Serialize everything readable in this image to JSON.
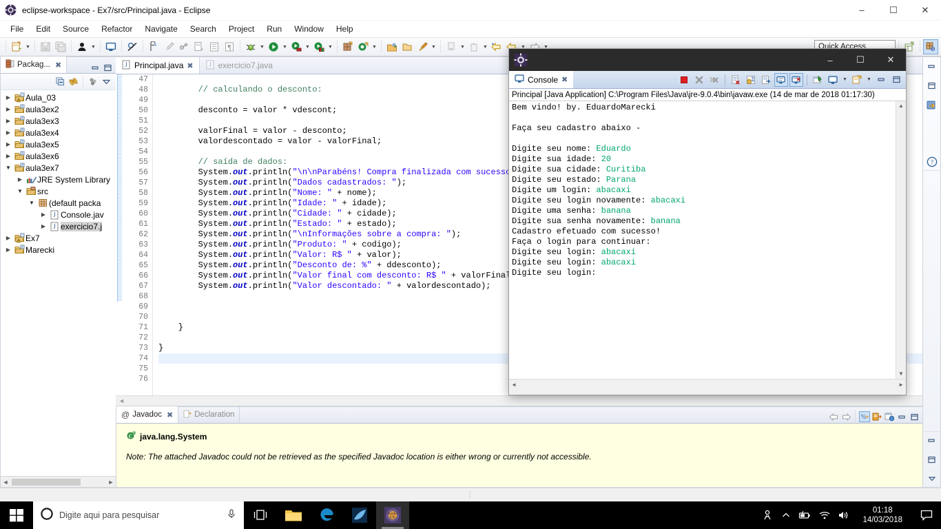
{
  "window": {
    "title": "eclipse-workspace - Ex7/src/Principal.java - Eclipse",
    "icon": "eclipse-icon",
    "minimize": "–",
    "maximize": "☐",
    "close": "✕"
  },
  "menubar": {
    "items": [
      "File",
      "Edit",
      "Source",
      "Refactor",
      "Navigate",
      "Search",
      "Project",
      "Run",
      "Window",
      "Help"
    ]
  },
  "toolbar": {
    "quick_access_label": "Quick Access",
    "icons": [
      "new-wizard-icon",
      "save-icon",
      "save-all-icon",
      "person-icon",
      "console-icon",
      "skip-breakpoints-icon",
      "toggle-mark-occurrences-icon",
      "brush-icon",
      "link-icon",
      "open-type-icon",
      "outline-icon",
      "pilcrow-icon",
      "debug-icon",
      "run-icon",
      "run-last-tool-icon",
      "coverage-icon",
      "new-java-project-icon",
      "new-annotation-icon",
      "open-task-icon",
      "open-folder-icon",
      "edit-icon",
      "previous-annotation-icon",
      "next-annotation-icon",
      "back-icon",
      "forward-icon"
    ],
    "perspective_icons": [
      "open-perspective-icon",
      "java-perspective-icon"
    ]
  },
  "package_explorer": {
    "tab_label": "Packag...",
    "tab_icon": "package-explorer-icon",
    "close_icon": "close-icon",
    "minimize_icon": "minimize-icon",
    "maximize_icon": "maximize-icon",
    "toolbar_icons": [
      "collapse-all-icon",
      "link-with-editor-icon",
      "view-menu-filter-icon",
      "view-menu-icon"
    ],
    "tree": [
      {
        "label": "Aula_03",
        "indent": 0,
        "arrow": "collapsed",
        "icon": "java-project-warning-icon",
        "selected": false
      },
      {
        "label": "aula3ex2",
        "indent": 0,
        "arrow": "collapsed",
        "icon": "java-project-icon",
        "selected": false
      },
      {
        "label": "aula3ex3",
        "indent": 0,
        "arrow": "collapsed",
        "icon": "java-project-icon",
        "selected": false
      },
      {
        "label": "aula3ex4",
        "indent": 0,
        "arrow": "collapsed",
        "icon": "java-project-icon",
        "selected": false
      },
      {
        "label": "aula3ex5",
        "indent": 0,
        "arrow": "collapsed",
        "icon": "java-project-icon",
        "selected": false
      },
      {
        "label": "aula3ex6",
        "indent": 0,
        "arrow": "collapsed",
        "icon": "java-project-icon",
        "selected": false
      },
      {
        "label": "aula3ex7",
        "indent": 0,
        "arrow": "expanded",
        "icon": "java-project-icon",
        "selected": false
      },
      {
        "label": "JRE System Library",
        "indent": 1,
        "arrow": "collapsed",
        "icon": "library-icon",
        "selected": false
      },
      {
        "label": "src",
        "indent": 1,
        "arrow": "expanded",
        "icon": "source-folder-icon",
        "selected": false
      },
      {
        "label": "(default packa",
        "indent": 2,
        "arrow": "expanded",
        "icon": "package-icon",
        "selected": false
      },
      {
        "label": "Console.jav",
        "indent": 3,
        "arrow": "collapsed",
        "icon": "java-file-icon",
        "selected": false
      },
      {
        "label": "exercicio7.j",
        "indent": 3,
        "arrow": "collapsed",
        "icon": "java-file-icon",
        "selected": true
      },
      {
        "label": "Ex7",
        "indent": 0,
        "arrow": "collapsed",
        "icon": "java-project-warning-icon",
        "selected": false
      },
      {
        "label": "Marecki",
        "indent": 0,
        "arrow": "collapsed",
        "icon": "java-project-icon",
        "selected": false
      }
    ]
  },
  "editor": {
    "tabs": [
      {
        "label": "Principal.java",
        "active": true,
        "icon": "java-file-icon",
        "close_icon": "close-icon"
      },
      {
        "label": "exercicio7.java",
        "active": false,
        "icon": "java-file-icon",
        "close_icon": ""
      }
    ],
    "first_line_number": 47,
    "current_line": 74,
    "lines": [
      {
        "n": 47,
        "segments": []
      },
      {
        "n": 48,
        "segments": [
          {
            "t": "        ",
            "c": "plain"
          },
          {
            "t": "// calculando o desconto:",
            "c": "cmt"
          }
        ]
      },
      {
        "n": 49,
        "segments": []
      },
      {
        "n": 50,
        "segments": [
          {
            "t": "        desconto = valor * vdescont;",
            "c": "plain"
          }
        ]
      },
      {
        "n": 51,
        "segments": []
      },
      {
        "n": 52,
        "segments": [
          {
            "t": "        valorFinal = valor - desconto;",
            "c": "plain"
          }
        ]
      },
      {
        "n": 53,
        "segments": [
          {
            "t": "        valordescontado = valor - valorFinal;",
            "c": "plain"
          }
        ]
      },
      {
        "n": 54,
        "segments": []
      },
      {
        "n": 55,
        "segments": [
          {
            "t": "        ",
            "c": "plain"
          },
          {
            "t": "// saída de dados:",
            "c": "cmt"
          }
        ]
      },
      {
        "n": 56,
        "segments": [
          {
            "t": "        System.",
            "c": "plain"
          },
          {
            "t": "out",
            "c": "fld"
          },
          {
            "t": ".println(",
            "c": "plain"
          },
          {
            "t": "\"\\n\\nParabéns! Compra finalizada com sucesso!\"",
            "c": "str"
          },
          {
            "t": ");",
            "c": "plain"
          }
        ]
      },
      {
        "n": 57,
        "segments": [
          {
            "t": "        System.",
            "c": "plain"
          },
          {
            "t": "out",
            "c": "fld"
          },
          {
            "t": ".println(",
            "c": "plain"
          },
          {
            "t": "\"Dados cadastrados: \"",
            "c": "str"
          },
          {
            "t": ");",
            "c": "plain"
          }
        ]
      },
      {
        "n": 58,
        "segments": [
          {
            "t": "        System.",
            "c": "plain"
          },
          {
            "t": "out",
            "c": "fld"
          },
          {
            "t": ".println(",
            "c": "plain"
          },
          {
            "t": "\"Nome: \"",
            "c": "str"
          },
          {
            "t": " + nome);",
            "c": "plain"
          }
        ]
      },
      {
        "n": 59,
        "segments": [
          {
            "t": "        System.",
            "c": "plain"
          },
          {
            "t": "out",
            "c": "fld"
          },
          {
            "t": ".println(",
            "c": "plain"
          },
          {
            "t": "\"Idade: \"",
            "c": "str"
          },
          {
            "t": " + idade);",
            "c": "plain"
          }
        ]
      },
      {
        "n": 60,
        "segments": [
          {
            "t": "        System.",
            "c": "plain"
          },
          {
            "t": "out",
            "c": "fld"
          },
          {
            "t": ".println(",
            "c": "plain"
          },
          {
            "t": "\"Cidade: \"",
            "c": "str"
          },
          {
            "t": " + cidade);",
            "c": "plain"
          }
        ]
      },
      {
        "n": 61,
        "segments": [
          {
            "t": "        System.",
            "c": "plain"
          },
          {
            "t": "out",
            "c": "fld"
          },
          {
            "t": ".println(",
            "c": "plain"
          },
          {
            "t": "\"Estado: \"",
            "c": "str"
          },
          {
            "t": " + estado);",
            "c": "plain"
          }
        ]
      },
      {
        "n": 62,
        "segments": [
          {
            "t": "        System.",
            "c": "plain"
          },
          {
            "t": "out",
            "c": "fld"
          },
          {
            "t": ".println(",
            "c": "plain"
          },
          {
            "t": "\"\\nInformações sobre a compra: \"",
            "c": "str"
          },
          {
            "t": ");",
            "c": "plain"
          }
        ]
      },
      {
        "n": 63,
        "segments": [
          {
            "t": "        System.",
            "c": "plain"
          },
          {
            "t": "out",
            "c": "fld"
          },
          {
            "t": ".println(",
            "c": "plain"
          },
          {
            "t": "\"Produto: \"",
            "c": "str"
          },
          {
            "t": " + codigo);",
            "c": "plain"
          }
        ]
      },
      {
        "n": 64,
        "segments": [
          {
            "t": "        System.",
            "c": "plain"
          },
          {
            "t": "out",
            "c": "fld"
          },
          {
            "t": ".println(",
            "c": "plain"
          },
          {
            "t": "\"Valor: R$ \"",
            "c": "str"
          },
          {
            "t": " + valor);",
            "c": "plain"
          }
        ]
      },
      {
        "n": 65,
        "segments": [
          {
            "t": "        System.",
            "c": "plain"
          },
          {
            "t": "out",
            "c": "fld"
          },
          {
            "t": ".println(",
            "c": "plain"
          },
          {
            "t": "\"Desconto de: %\"",
            "c": "str"
          },
          {
            "t": " + ddesconto);",
            "c": "plain"
          }
        ]
      },
      {
        "n": 66,
        "segments": [
          {
            "t": "        System.",
            "c": "plain"
          },
          {
            "t": "out",
            "c": "fld"
          },
          {
            "t": ".println(",
            "c": "plain"
          },
          {
            "t": "\"Valor final com desconto: R$ \"",
            "c": "str"
          },
          {
            "t": " + valorFinal);",
            "c": "plain"
          }
        ]
      },
      {
        "n": 67,
        "segments": [
          {
            "t": "        System.",
            "c": "plain"
          },
          {
            "t": "out",
            "c": "fld"
          },
          {
            "t": ".println(",
            "c": "plain"
          },
          {
            "t": "\"Valor descontado: \"",
            "c": "str"
          },
          {
            "t": " + valordescontado);",
            "c": "plain"
          }
        ]
      },
      {
        "n": 68,
        "segments": []
      },
      {
        "n": 69,
        "segments": []
      },
      {
        "n": 70,
        "segments": []
      },
      {
        "n": 71,
        "segments": [
          {
            "t": "    }",
            "c": "plain"
          }
        ]
      },
      {
        "n": 72,
        "segments": []
      },
      {
        "n": 73,
        "segments": [
          {
            "t": "}",
            "c": "plain"
          }
        ]
      },
      {
        "n": 74,
        "segments": []
      },
      {
        "n": 75,
        "segments": []
      },
      {
        "n": 76,
        "segments": []
      }
    ]
  },
  "javadoc_view": {
    "tabs": [
      {
        "label": "Javadoc",
        "icon": "at-icon",
        "active": true,
        "close_icon": "close-icon"
      },
      {
        "label": "Declaration",
        "icon": "declaration-icon",
        "active": false,
        "close_icon": ""
      }
    ],
    "toolbar_icons": [
      "back-icon",
      "forward-icon",
      "show-source-icon",
      "open-attached-javadoc-icon",
      "open-browser-icon",
      "minimize-icon",
      "maximize-icon"
    ],
    "element_icon": "class-icon",
    "element_name": "java.lang.System",
    "note": "Note: The attached Javadoc could not be retrieved as the specified Javadoc location is either wrong or currently not accessible."
  },
  "right_strip": {
    "icons": [
      "minimize-icon",
      "maximize-icon",
      "package-explorer-restore-icon",
      "help-icon",
      "view-menu-icon"
    ]
  },
  "console_window": {
    "titlebar_icon": "eclipse-icon",
    "minimize": "–",
    "maximize": "☐",
    "close": "✕",
    "tab_label": "Console",
    "tab_icon": "console-icon",
    "tab_close_icon": "close-icon",
    "toolbar_icons": [
      "terminate-icon",
      "remove-launch-icon",
      "remove-all-terminated-icon",
      "clear-console-icon",
      "lock-scroll-icon",
      "scroll-lock-icon",
      "show-console-on-output-icon",
      "show-console-on-error-icon",
      "pin-console-icon",
      "display-selected-console-icon",
      "display-selected-console-dropdown-icon",
      "open-console-icon",
      "open-console-dropdown-icon",
      "minimize-icon",
      "maximize-icon"
    ],
    "launch_path": "Principal [Java Application] C:\\Program Files\\Java\\jre-9.0.4\\bin\\javaw.exe (14 de mar de 2018 01:17:30)",
    "output_lines": [
      [
        {
          "t": "Bem vindo! by. EduardoMarecki",
          "c": "out"
        }
      ],
      [],
      [
        {
          "t": "Faça seu cadastro abaixo -",
          "c": "out"
        }
      ],
      [],
      [
        {
          "t": "Digite seu nome: ",
          "c": "out"
        },
        {
          "t": "Eduardo",
          "c": "in"
        }
      ],
      [
        {
          "t": "Digite sua idade: ",
          "c": "out"
        },
        {
          "t": "20",
          "c": "in"
        }
      ],
      [
        {
          "t": "Digite sua cidade: ",
          "c": "out"
        },
        {
          "t": "Curitiba",
          "c": "in"
        }
      ],
      [
        {
          "t": "Digite seu estado: ",
          "c": "out"
        },
        {
          "t": "Parana",
          "c": "in"
        }
      ],
      [
        {
          "t": "Digite um login: ",
          "c": "out"
        },
        {
          "t": "abacaxi",
          "c": "in"
        }
      ],
      [
        {
          "t": "Digite seu login novamente: ",
          "c": "out"
        },
        {
          "t": "abacaxi",
          "c": "in"
        }
      ],
      [
        {
          "t": "Digite uma senha: ",
          "c": "out"
        },
        {
          "t": "banana",
          "c": "in"
        }
      ],
      [
        {
          "t": "Digite sua senha novamente: ",
          "c": "out"
        },
        {
          "t": "banana",
          "c": "in"
        }
      ],
      [
        {
          "t": "Cadastro efetuado com sucesso!",
          "c": "out"
        }
      ],
      [
        {
          "t": "Faça o login para continuar:",
          "c": "out"
        }
      ],
      [
        {
          "t": "Digite seu login: ",
          "c": "out"
        },
        {
          "t": "abacaxi",
          "c": "in"
        }
      ],
      [
        {
          "t": "Digite seu login: ",
          "c": "out"
        },
        {
          "t": "abacaxi",
          "c": "in"
        }
      ],
      [
        {
          "t": "Digite seu login:",
          "c": "out"
        }
      ]
    ]
  },
  "taskbar": {
    "start_icon": "windows-start-icon",
    "search_icon": "cortana-circle-icon",
    "search_placeholder": "Digite aqui para pesquisar",
    "mic_icon": "microphone-icon",
    "taskview_icon": "task-view-icon",
    "apps": [
      {
        "name": "file-explorer-icon",
        "active": false
      },
      {
        "name": "edge-browser-icon",
        "active": false
      },
      {
        "name": "dolphin-icon",
        "active": false
      },
      {
        "name": "eclipse-javaee-icon",
        "active": true
      }
    ],
    "tray": [
      "people-icon",
      "show-hidden-icons-icon",
      "battery-icon",
      "wifi-icon",
      "volume-icon"
    ],
    "time": "01:18",
    "date": "14/03/2018",
    "action_center_icon": "action-center-icon"
  },
  "colors": {
    "comment": "#3f7f5f",
    "string": "#2a00ff",
    "field": "#0000c0",
    "console_input": "#00a572",
    "selection": "#d4d4d4",
    "current_line": "#e8f2fe",
    "javadoc_bg": "#ffffe1"
  }
}
